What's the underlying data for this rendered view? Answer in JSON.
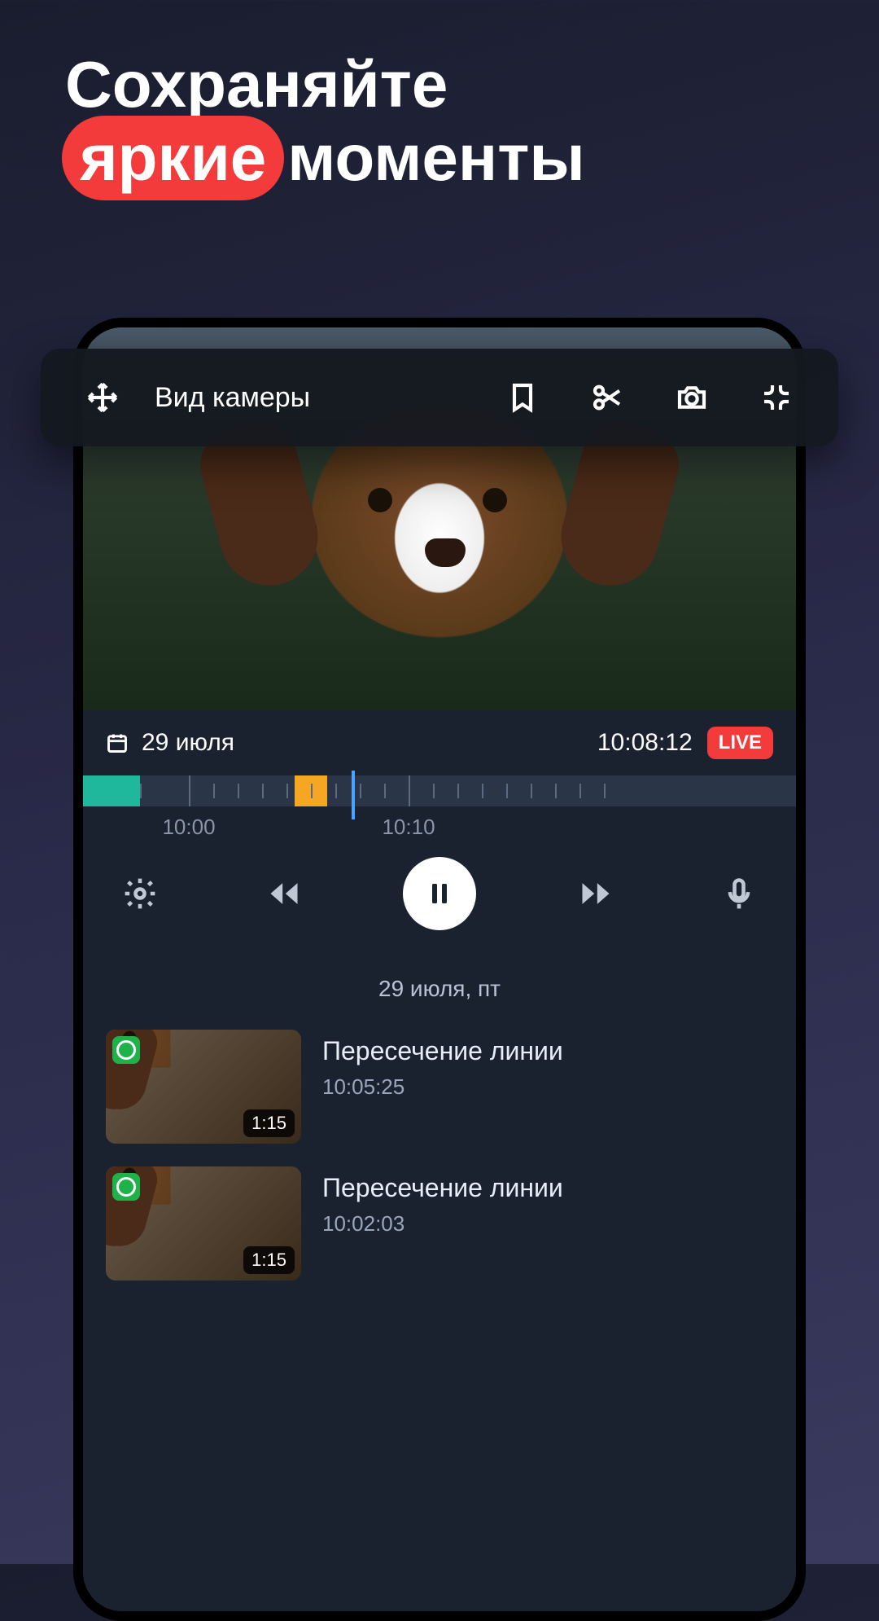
{
  "headline": {
    "line1": "Сохраняйте",
    "highlight": "яркие",
    "line2_rest": "моменты"
  },
  "toolbar": {
    "view_label": "Вид камеры",
    "icons": {
      "move": "move-icon",
      "bookmark": "bookmark-icon",
      "scissors": "scissors-icon",
      "camera": "camera-icon",
      "collapse": "collapse-icon"
    }
  },
  "player": {
    "date": "29 июля",
    "time": "10:08:12",
    "live_label": "LIVE",
    "timeline": {
      "labels": {
        "t1": "10:00",
        "t2": "10:10"
      }
    }
  },
  "events": {
    "date_header": "29 июля, пт",
    "items": [
      {
        "title": "Пересечение линии",
        "time": "10:05:25",
        "duration": "1:15"
      },
      {
        "title": "Пересечение линии",
        "time": "10:02:03",
        "duration": "1:15"
      }
    ]
  }
}
